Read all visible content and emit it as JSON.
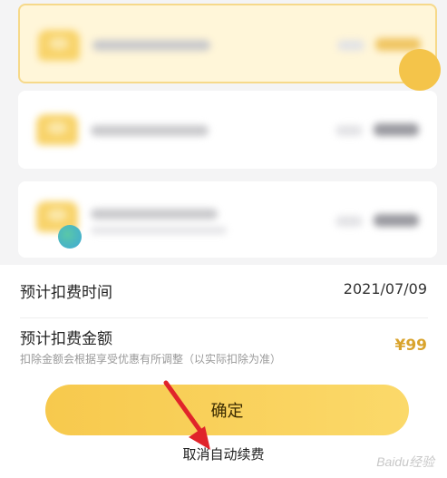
{
  "sheet": {
    "schedule_label": "预计扣费时间",
    "schedule_value": "2021/07/09",
    "amount_label": "预计扣费金额",
    "amount_note": "扣除金额会根据享受优惠有所调整（以实际扣除为准）",
    "amount_value": "¥99",
    "confirm_label": "确定",
    "cancel_label": "取消自动续费"
  },
  "watermark": {
    "text": "Baidu经验"
  },
  "colors": {
    "accent": "#f7c94d",
    "price": "#d9a32c"
  }
}
